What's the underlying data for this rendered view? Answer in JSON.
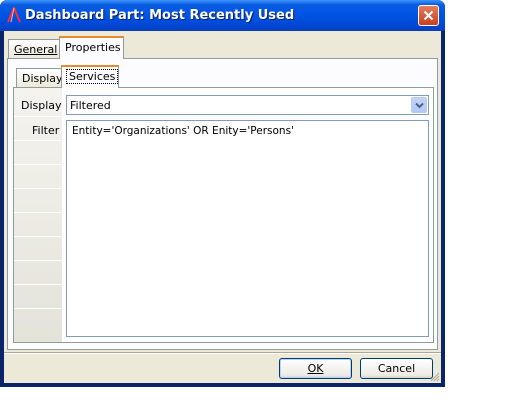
{
  "window": {
    "title": "Dashboard Part: Most Recently Used",
    "close_icon": "close-icon",
    "app_icon": "app-logo-icon"
  },
  "tabs": [
    {
      "label": "General",
      "selected": false
    },
    {
      "label": "Properties",
      "selected": true
    }
  ],
  "subtabs": [
    {
      "label": "Display",
      "selected": false
    },
    {
      "label": "Services",
      "selected": true
    }
  ],
  "form": {
    "display_label": "Display",
    "display_value": "Filtered",
    "filter_label": "Filter",
    "filter_value": "Entity='Organizations' OR Enity='Persons'"
  },
  "buttons": {
    "ok": "OK",
    "cancel": "Cancel"
  },
  "colors": {
    "titlebar": "#0055e5",
    "face": "#ece9d8",
    "tab_highlight": "#e68b2c",
    "close": "#c9401c"
  }
}
